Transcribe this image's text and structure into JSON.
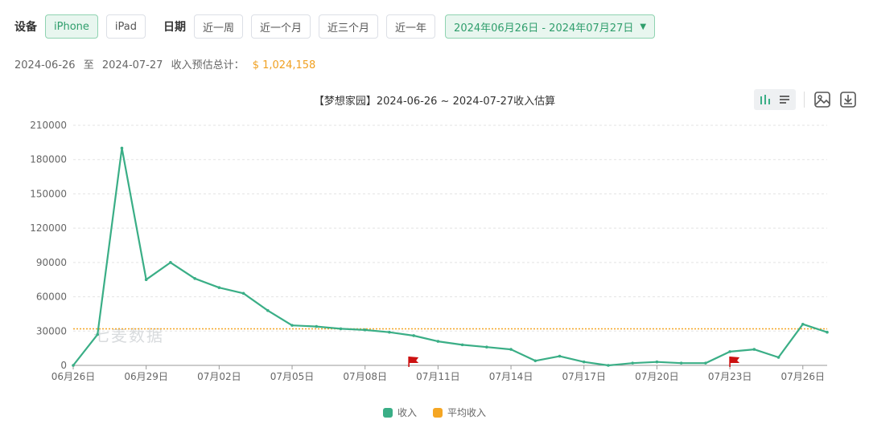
{
  "filters": {
    "device_label": "设备",
    "devices": [
      "iPhone",
      "iPad"
    ],
    "active_device": "iPhone",
    "date_label": "日期",
    "ranges": [
      "近一周",
      "近一个月",
      "近三个月",
      "近一年"
    ],
    "date_range": "2024年06月26日 - 2024年07月27日"
  },
  "summary": {
    "from": "2024-06-26",
    "to_word": "至",
    "to": "2024-07-27",
    "label": "收入预估总计：",
    "total": "$ 1,024,158"
  },
  "watermark": "七麦数据",
  "toolbox": {
    "icons": [
      "bar-chart-icon",
      "list-icon",
      "image-save-icon",
      "download-icon"
    ]
  },
  "colors": {
    "income": "#3aae86",
    "average": "#f5a623",
    "flag": "#cc1111",
    "accent": "#2f9e6c"
  },
  "chart_data": {
    "type": "line",
    "title": "【梦想家园】2024-06-26 ~ 2024-07-27收入估算",
    "x": [
      "06月26日",
      "06月27日",
      "06月28日",
      "06月29日",
      "06月30日",
      "07月01日",
      "07月02日",
      "07月03日",
      "07月04日",
      "07月05日",
      "07月06日",
      "07月07日",
      "07月08日",
      "07月09日",
      "07月10日",
      "07月11日",
      "07月12日",
      "07月13日",
      "07月14日",
      "07月15日",
      "07月16日",
      "07月17日",
      "07月18日",
      "07月19日",
      "07月20日",
      "07月21日",
      "07月22日",
      "07月23日",
      "07月24日",
      "07月25日",
      "07月26日",
      "07月27日"
    ],
    "xticks": [
      "06月26日",
      "06月29日",
      "07月02日",
      "07月05日",
      "07月08日",
      "07月11日",
      "07月14日",
      "07月17日",
      "07月20日",
      "07月23日",
      "07月26日"
    ],
    "yticks": [
      0,
      30000,
      60000,
      90000,
      120000,
      150000,
      180000,
      210000
    ],
    "ylim": [
      0,
      210000
    ],
    "series": [
      {
        "name": "收入",
        "values": [
          0,
          27000,
          190000,
          75000,
          90000,
          76000,
          68000,
          63000,
          48000,
          35000,
          34000,
          32000,
          31000,
          29000,
          26000,
          21000,
          18000,
          16000,
          14000,
          4000,
          8000,
          3000,
          0,
          2000,
          3000,
          2000,
          2000,
          12000,
          14000,
          7000,
          36000,
          29000
        ]
      },
      {
        "name": "平均收入",
        "values": [
          32000
        ]
      }
    ],
    "markers": [
      {
        "type": "flag",
        "x": "07月10日"
      },
      {
        "type": "flag",
        "x": "07月23日"
      }
    ],
    "grid": true,
    "legend": "bottom-center"
  }
}
